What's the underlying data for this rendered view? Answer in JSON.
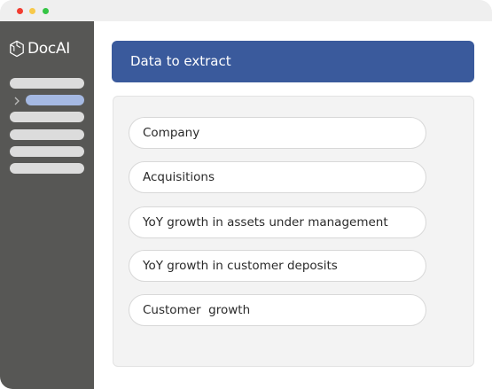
{
  "app": {
    "name": "DocAI"
  },
  "sidebar": {
    "icon": "hexagon-logo-icon",
    "active_index": 1,
    "items": [
      "",
      "",
      "",
      "",
      "",
      ""
    ]
  },
  "main": {
    "header_title": "Data to extract",
    "fields": [
      "Company",
      "Acquisitions",
      "YoY growth in assets under management",
      "YoY growth in customer deposits",
      "Customer  growth"
    ]
  },
  "colors": {
    "header": "#3a5a9c",
    "sidebar": "#575755",
    "active_item": "#a5b9e3"
  }
}
